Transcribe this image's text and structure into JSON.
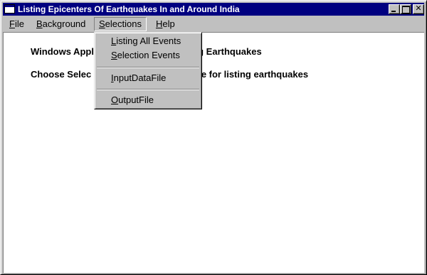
{
  "window": {
    "title": "Listing Epicenters Of Earthquakes In and Around India"
  },
  "menubar": {
    "items": [
      {
        "pre": "",
        "key": "F",
        "post": "ile"
      },
      {
        "pre": "",
        "key": "B",
        "post": "ackground"
      },
      {
        "pre": "",
        "key": "S",
        "post": "elections"
      },
      {
        "pre": "",
        "key": "H",
        "post": "elp"
      }
    ]
  },
  "selections_menu": {
    "items": [
      {
        "pre": "",
        "key": "L",
        "post": "isting All Events"
      },
      {
        "pre": "",
        "key": "S",
        "post": "election Events"
      },
      {
        "pre": "",
        "key": "I",
        "post": "nputDataFile"
      },
      {
        "pre": "",
        "key": "O",
        "post": "utputFile"
      }
    ]
  },
  "content": {
    "line1_left": "Windows Appl",
    "line1_right": "nd Listing Earthquakes",
    "line2_left": "Choose Selec",
    "line2_right": "file for listing earthquakes"
  }
}
